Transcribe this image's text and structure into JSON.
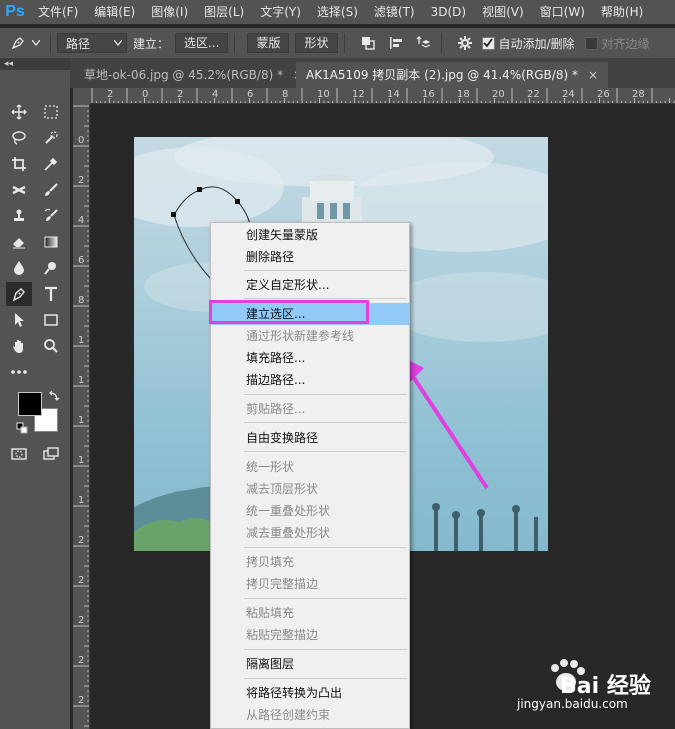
{
  "app": {
    "logo": "Ps"
  },
  "menubar": {
    "items": [
      "文件(F)",
      "编辑(E)",
      "图像(I)",
      "图层(L)",
      "文字(Y)",
      "选择(S)",
      "滤镜(T)",
      "3D(D)",
      "视图(V)",
      "窗口(W)",
      "帮助(H)"
    ]
  },
  "options": {
    "mode_value": "路径",
    "make_label": "建立：",
    "selection_btn": "选区...",
    "mask_btn": "蒙版",
    "shape_btn": "形状",
    "auto_add_delete": "自动添加/删除",
    "align_edges": "对齐边缘",
    "icons": [
      "pen-icon",
      "path-operations-icon",
      "path-alignment-icon",
      "path-arrangement-icon",
      "gear-icon"
    ]
  },
  "toolpanel": {
    "collapse_glyph": "◂◂"
  },
  "tabs": [
    {
      "title": "草地-ok-06.jpg @ 45.2%(RGB/8) *",
      "close": "×"
    },
    {
      "title": "AK1A5109 拷贝副本 (2).jpg @ 41.4%(RGB/8) *",
      "close": "×"
    }
  ],
  "ruler": {
    "h_ticks": [
      "2",
      "0",
      "2",
      "4",
      "6",
      "8",
      "10",
      "12",
      "14",
      "16",
      "18",
      "20",
      "22",
      "24",
      "26",
      "28"
    ],
    "v_ticks": [
      "0",
      "2",
      "4",
      "6",
      "8",
      "1",
      "1",
      "1",
      "1",
      "1",
      "2",
      "2",
      "2",
      "2",
      "2"
    ]
  },
  "context_menu": {
    "items": [
      {
        "label": "创建矢量蒙版",
        "disabled": false
      },
      {
        "label": "删除路径",
        "disabled": false
      },
      {
        "label": "定义自定形状...",
        "disabled": false
      },
      {
        "label": "建立选区...",
        "disabled": false,
        "highlighted": true
      },
      {
        "label": "通过形状新建参考线",
        "disabled": true
      },
      {
        "label": "填充路径...",
        "disabled": false
      },
      {
        "label": "描边路径...",
        "disabled": false
      },
      {
        "label": "剪贴路径...",
        "disabled": true
      },
      {
        "label": "自由变换路径",
        "disabled": false
      },
      {
        "label": "统一形状",
        "disabled": true
      },
      {
        "label": "减去顶层形状",
        "disabled": true
      },
      {
        "label": "统一重叠处形状",
        "disabled": true
      },
      {
        "label": "减去重叠处形状",
        "disabled": true
      },
      {
        "label": "拷贝填充",
        "disabled": true
      },
      {
        "label": "拷贝完整描边",
        "disabled": true
      },
      {
        "label": "粘贴填充",
        "disabled": true
      },
      {
        "label": "粘贴完整描边",
        "disabled": true
      },
      {
        "label": "隔离图层",
        "disabled": false
      },
      {
        "label": "将路径转换为凸出",
        "disabled": false
      },
      {
        "label": "从路径创建约束",
        "disabled": true
      }
    ]
  },
  "annotation": {
    "color": "#e040e0"
  },
  "watermark": {
    "brand": "Bai 经验",
    "url": "jingyan.baidu.com"
  }
}
